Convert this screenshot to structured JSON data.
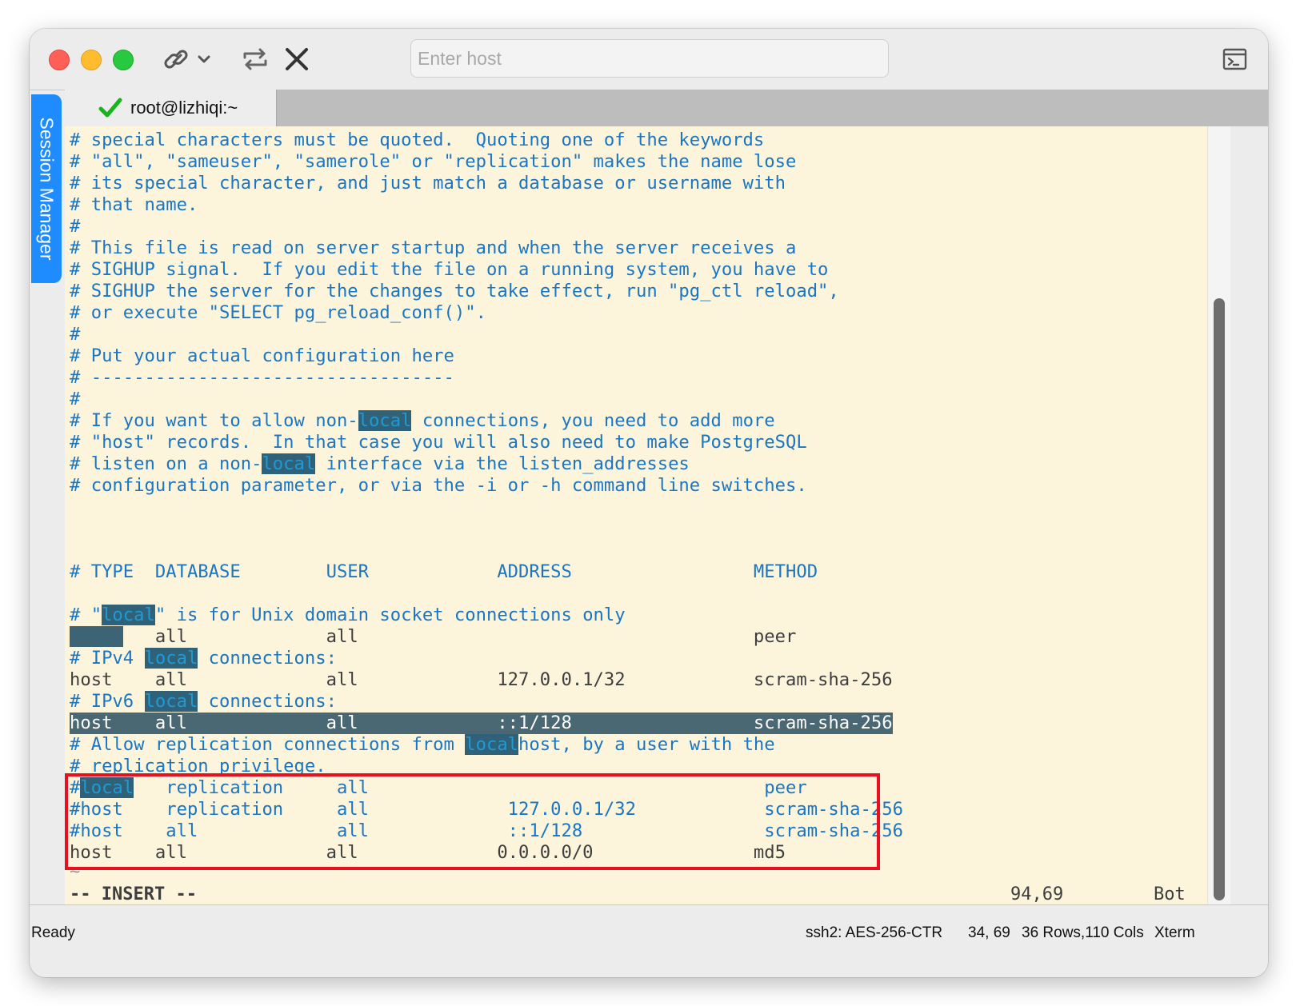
{
  "toolbar": {
    "host_placeholder": "Enter host",
    "host_value": ""
  },
  "side_panel": {
    "label": "Session Manager"
  },
  "tab": {
    "title": "root@lizhiqi:~",
    "status": "connected"
  },
  "terminal": {
    "lines": [
      "# special characters must be quoted.  Quoting one of the keywords",
      "# \"all\", \"sameuser\", \"samerole\" or \"replication\" makes the name lose",
      "# its special character, and just match a database or username with",
      "# that name.",
      "#",
      "# This file is read on server startup and when the server receives a",
      "# SIGHUP signal.  If you edit the file on a running system, you have to",
      "# SIGHUP the server for the changes to take effect, run \"pg_ctl reload\",",
      "# or execute \"SELECT pg_reload_conf()\".",
      "#",
      "# Put your actual configuration here",
      "# ----------------------------------",
      "#",
      "# If you want to allow non-local connections, you need to add more",
      "# \"host\" records.  In that case you will also need to make PostgreSQL",
      "# listen on a non-local interface via the listen_addresses",
      "# configuration parameter, or via the -i or -h command line switches.",
      "",
      "",
      "# TYPE  DATABASE        USER            ADDRESS                 METHOD",
      "",
      "# \"local\" is for Unix domain socket connections only",
      "local   all             all                                     peer",
      "# IPv4 local connections:",
      "host    all             all             127.0.0.1/32            scram-sha-256",
      "# IPv6 local connections:",
      "host    all             all             ::1/128                 scram-sha-256",
      "# Allow replication connections from localhost, by a user with the",
      "# replication privilege.",
      "#local   replication     all                                     peer",
      "#host    replication     all             127.0.0.1/32            scram-sha-256",
      "#host    all             all             ::1/128                 scram-sha-256",
      "host    all             all             0.0.0.0/0               md5",
      "~"
    ],
    "search_highlight": "local",
    "mode": "-- INSERT --",
    "cursor_position": "94,69",
    "scroll_position": "Bot"
  },
  "statusbar": {
    "status": "Ready",
    "cipher": "ssh2: AES-256-CTR",
    "cursor": "34, 69",
    "size": "36 Rows,110 Cols",
    "terminal_type": "Xterm"
  },
  "colors": {
    "terminal_bg": "#fdf4dc",
    "comment": "#1a76c2",
    "plain": "#3e3e3e",
    "highlight_bg": "#2f6178",
    "cursorline_bg": "#4a6874",
    "annotation_box": "#e8101e",
    "side_tab": "#1e8cff"
  },
  "icons": [
    "link-icon",
    "chevron-down-icon",
    "refresh-icon",
    "close-icon",
    "sidebar-toggle-icon",
    "check-icon"
  ]
}
